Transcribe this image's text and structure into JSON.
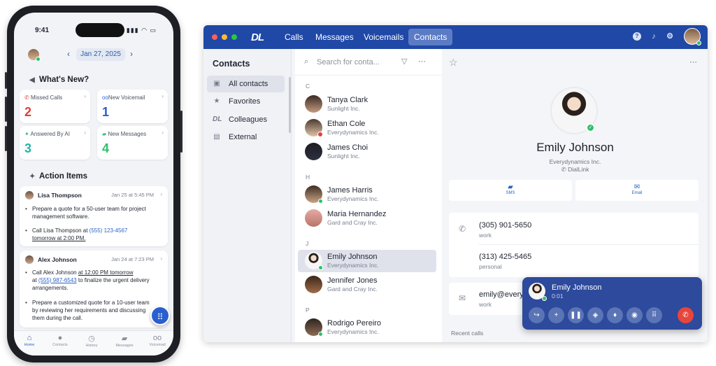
{
  "phone": {
    "status_time": "9:41",
    "status_icons": "▮▮▮ ◠ ▭",
    "date": "Jan 27, 2025",
    "whats_new_title": "What's New?",
    "tiles": [
      {
        "label": "Missed Calls",
        "value": "2",
        "color": "#e0403c",
        "icon": "missed-call-icon"
      },
      {
        "label": "New Voicemail",
        "value": "1",
        "color": "#2a5fcf",
        "icon": "voicemail-icon"
      },
      {
        "label": "Answered By AI",
        "value": "3",
        "color": "#2ab3a6",
        "icon": "sparkle-icon"
      },
      {
        "label": "New Messages",
        "value": "4",
        "color": "#2fbf6b",
        "icon": "message-icon"
      }
    ],
    "action_items_title": "Action Items",
    "cards": [
      {
        "name": "Lisa Thompson",
        "time": "Jan 25 at 5:45 PM",
        "b1": "Prepare a quote for a 50-user team for project management software.",
        "b2_prefix": "Call Lisa Thompson at ",
        "b2_phone": "(555) 123-4567",
        "b2_suffix": "tomorrow at 2:00 PM."
      },
      {
        "name": "Alex Johnson",
        "time": "Jan 24 at 7:23 PM",
        "b1_prefix": "Call Alex Johnson ",
        "b1_mid": "at 12:00 PM tomorrow",
        "b1_at": "at ",
        "b1_phone": "(555) 987-6543",
        "b1_suffix": " to finalize the urgent delivery arrangements.",
        "b2": "Prepare a customized quote for a 10-user team by reviewing her requirements and discussing them during the call."
      }
    ],
    "tabs": [
      "Home",
      "Contacts",
      "History",
      "Messages",
      "Voicemail"
    ]
  },
  "app": {
    "logo": "DL",
    "nav": [
      "Calls",
      "Messages",
      "Voicemails",
      "Contacts"
    ],
    "active_nav": "Contacts",
    "sidebar": {
      "title": "Contacts",
      "items": [
        "All contacts",
        "Favorites",
        "Colleagues",
        "External"
      ]
    },
    "search_placeholder": "Search for conta...",
    "groups": [
      {
        "letter": "C",
        "contacts": [
          {
            "name": "Tanya Clark",
            "org": "Sunlight Inc."
          },
          {
            "name": "Ethan Cole",
            "org": "Everydynamics Inc."
          },
          {
            "name": "James Choi",
            "org": "Sunlight Inc."
          }
        ]
      },
      {
        "letter": "H",
        "contacts": [
          {
            "name": "James Harris",
            "org": "Everydynamics Inc."
          },
          {
            "name": "Maria Hernandez",
            "org": "Gard and Cray Inc."
          }
        ]
      },
      {
        "letter": "J",
        "contacts": [
          {
            "name": "Emily Johnson",
            "org": "Everydynamics Inc."
          },
          {
            "name": "Jennifer Jones",
            "org": "Gard and Cray Inc."
          }
        ]
      },
      {
        "letter": "P",
        "contacts": [
          {
            "name": "Rodrigo Pereiro",
            "org": "Everydynamics Inc."
          }
        ]
      }
    ],
    "detail": {
      "name": "Emily Johnson",
      "org": "Everydynamics Inc.",
      "app": "DialLink",
      "actions": [
        "SMS",
        "Email"
      ],
      "phones": [
        {
          "number": "(305) 901-5650",
          "type": "work"
        },
        {
          "number": "(313) 425-5465",
          "type": "personal"
        }
      ],
      "email": {
        "value": "emily@every",
        "type": "work"
      },
      "recent_calls": "Recent calls"
    },
    "call": {
      "name": "Emily Johnson",
      "duration": "0:01"
    }
  },
  "colors": {
    "brand": "#1f48a7",
    "accent": "#2a63c6",
    "online": "#2fbf6b",
    "end_call": "#e8453c"
  }
}
